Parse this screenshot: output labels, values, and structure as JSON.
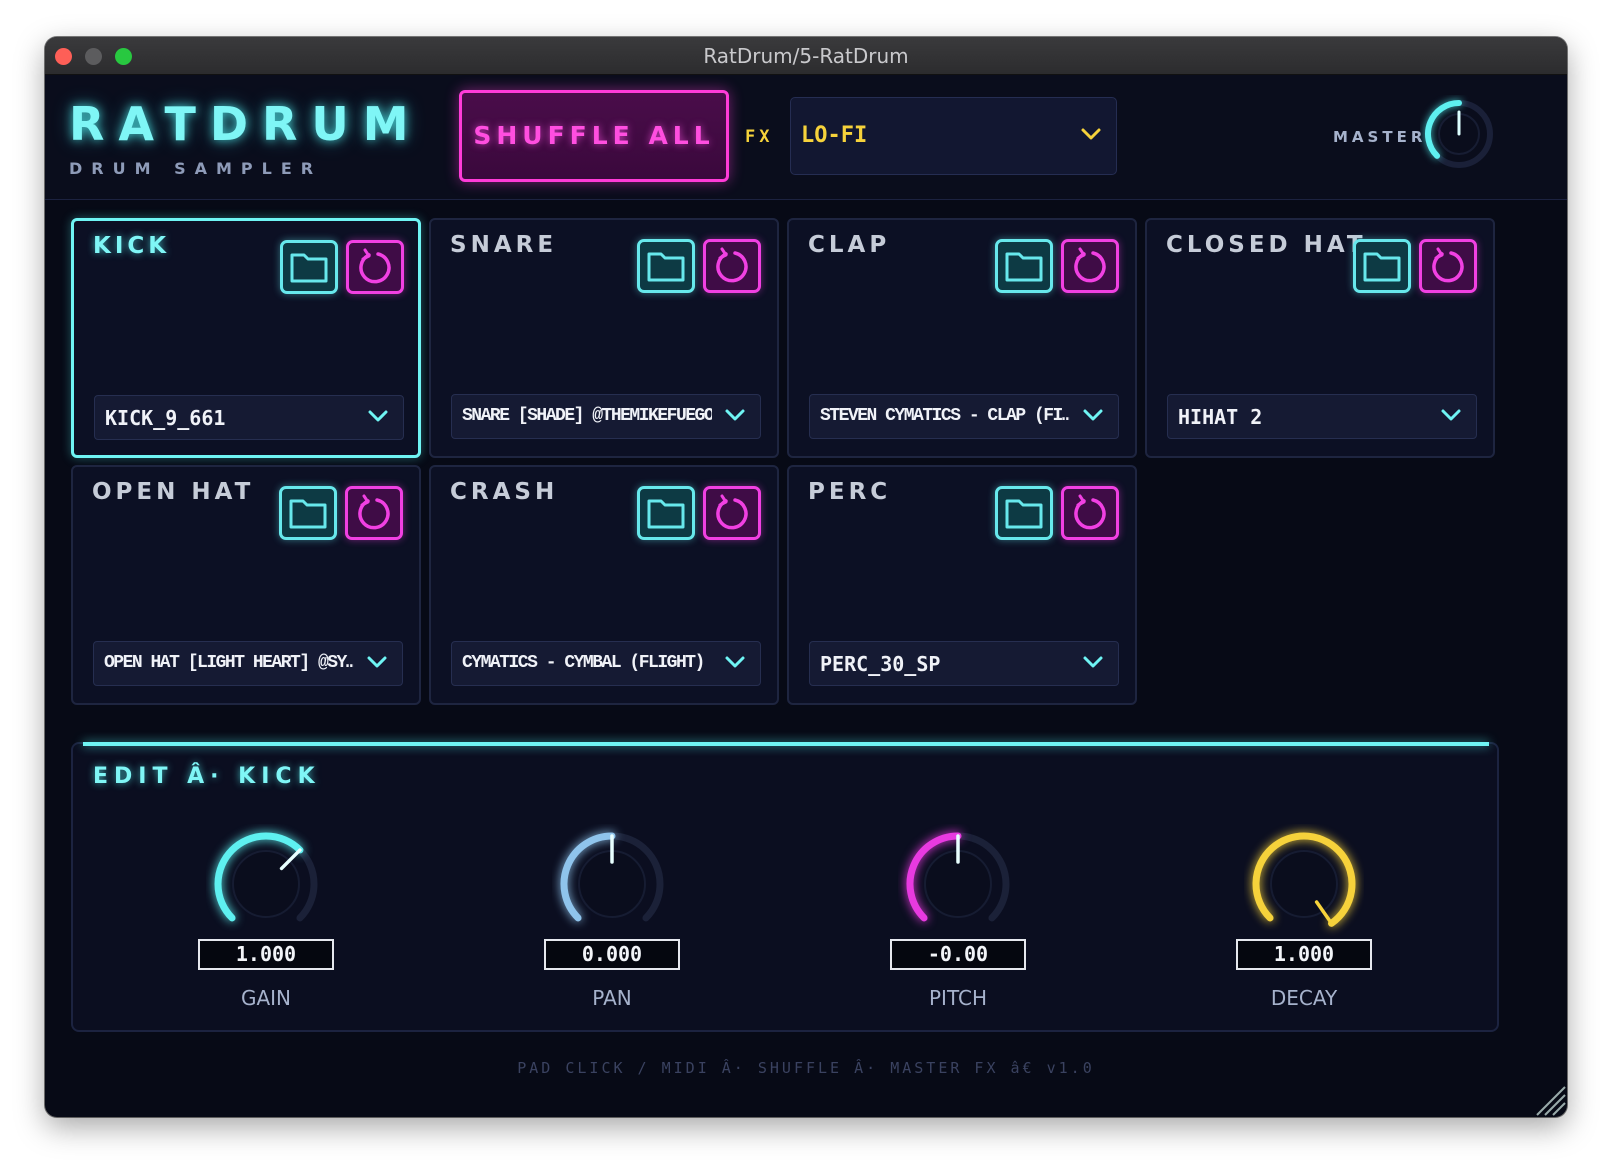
{
  "window": {
    "title": "RatDrum/5-RatDrum"
  },
  "header": {
    "logo": "RATDRUM",
    "logo_sub": "DRUM SAMPLER",
    "shuffle_label": "SHUFFLE ALL",
    "fx_label": "FX",
    "fx_value": "LO-FI",
    "master_label": "MASTER"
  },
  "pads": [
    {
      "name": "KICK",
      "sample": "KICK_9_661",
      "selected": true
    },
    {
      "name": "SNARE",
      "sample": "SNARE [SHADE] @THEMIKEFUEGO"
    },
    {
      "name": "CLAP",
      "sample": "STEVEN CYMATICS - CLAP (FI…"
    },
    {
      "name": "CLOSED HAT",
      "sample": "HIHAT 2"
    },
    {
      "name": "OPEN HAT",
      "sample": "OPEN HAT [LIGHT HEART] @SY…"
    },
    {
      "name": "CRASH",
      "sample": "CYMATICS - CYMBAL (FLIGHT)"
    },
    {
      "name": "PERC",
      "sample": "PERC_30_SP"
    }
  ],
  "edit": {
    "title": "EDIT Â· KICK",
    "knobs": [
      {
        "label": "GAIN",
        "value": "1.000",
        "color": "#5ef0f0"
      },
      {
        "label": "PAN",
        "value": "0.000",
        "color": "#8fc4ec"
      },
      {
        "label": "PITCH",
        "value": "-0.00",
        "color": "#e83ae0"
      },
      {
        "label": "DECAY",
        "value": "1.000",
        "color": "#f6d23b"
      }
    ]
  },
  "footer": "PAD CLICK / MIDI  Â·  SHUFFLE  Â·  MASTER FX  â€   v1.0",
  "colors": {
    "cyan": "#6ff4f4",
    "magenta": "#ff3bd8",
    "yellow": "#f6d23b",
    "background": "#070a16"
  },
  "icons": [
    "folder-icon",
    "reload-icon",
    "chevron-down-icon",
    "resize-grip-icon"
  ]
}
